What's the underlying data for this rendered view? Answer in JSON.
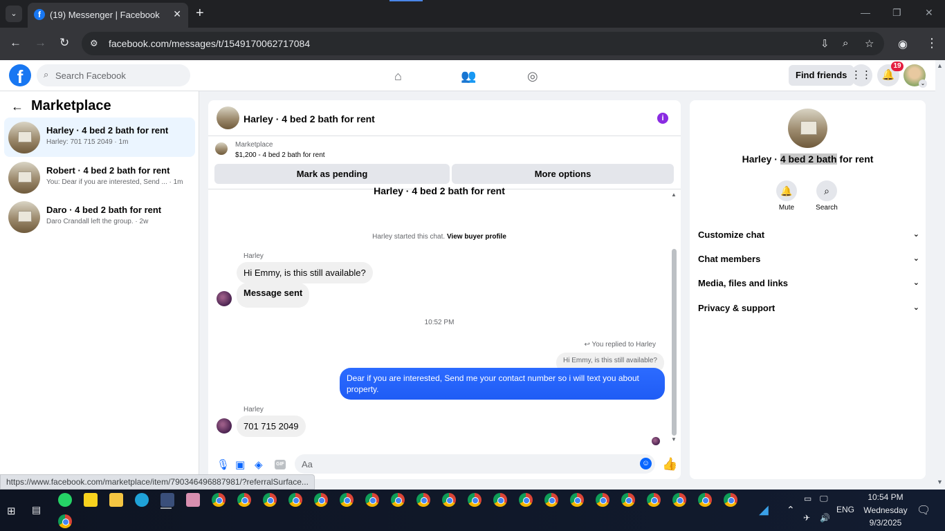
{
  "browser": {
    "tab_title": "(19) Messenger | Facebook",
    "url": "facebook.com/messages/t/1549170062717084",
    "new_tab_label": "+",
    "status_url": "https://www.facebook.com/marketplace/item/790346496887981/?referralSurface..."
  },
  "fb": {
    "search_placeholder": "Search Facebook",
    "find_friends": "Find friends",
    "notification_count": "19"
  },
  "sidebar": {
    "title": "Marketplace",
    "conversations": [
      {
        "name": "Harley · 4 bed 2 bath for rent",
        "sub": "Harley: 701 715 2049 · 1m"
      },
      {
        "name": "Robert · 4 bed 2 bath for rent",
        "sub": "You: Dear if you are interested, Send ... · 1m"
      },
      {
        "name": "Daro · 4 bed 2 bath for rent",
        "sub": "Daro Crandall left the group. · 2w"
      }
    ]
  },
  "chat": {
    "title": "Harley · 4 bed 2 bath for rent",
    "marketplace_label": "Marketplace",
    "listing": "$1,200 - 4 bed 2 bath for rent",
    "mark_pending": "Mark as pending",
    "more_options": "More options",
    "center_title": "Harley · 4 bed 2 bath for rent",
    "started_text": "Harley started this chat.",
    "view_buyer": "View buyer profile",
    "messages": [
      {
        "sender": "Harley",
        "text": "Hi Emmy, is this still available?"
      },
      {
        "text": "Message sent"
      }
    ],
    "timestamp": "10:52 PM",
    "reply_note": "You replied to Harley",
    "reply_quote": "Hi Emmy, is this still available?",
    "outgoing": "Dear if you are interested, Send me your contact number so i will text you about property.",
    "last_sender": "Harley",
    "last_message": "701 715 2049",
    "composer_placeholder": "Aa",
    "gif_label": "GIF"
  },
  "info": {
    "name_before": "Harley · ",
    "name_highlight": "4 bed 2 bath",
    "name_after": " for rent",
    "mute": "Mute",
    "search": "Search",
    "sections": [
      "Customize chat",
      "Chat members",
      "Media, files and links",
      "Privacy & support"
    ]
  },
  "taskbar": {
    "language": "ENG",
    "time": "10:54 PM",
    "day": "Wednesday",
    "date": "9/3/2025"
  }
}
